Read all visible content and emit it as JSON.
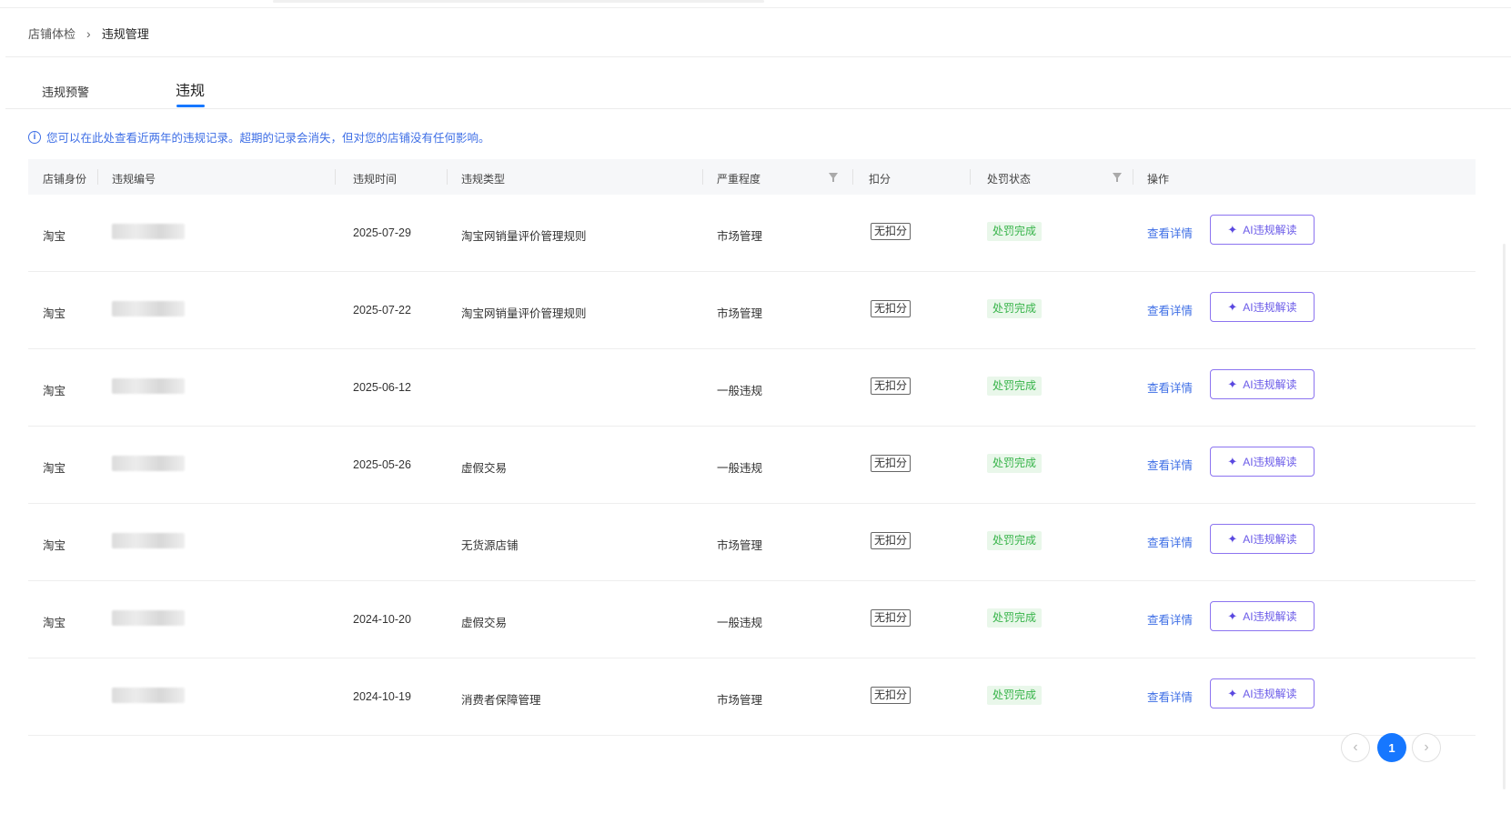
{
  "breadcrumb": {
    "parent": "店铺体检",
    "separator": "›",
    "current": "违规管理"
  },
  "tabs": [
    {
      "label": "违规预警"
    },
    {
      "label": "违规"
    }
  ],
  "notice": {
    "icon": "info-icon",
    "text": "您可以在此处查看近两年的违规记录。超期的记录会消失，但对您的店铺没有任何影响。"
  },
  "table": {
    "headers": {
      "shop": "店铺身份",
      "id": "违规编号",
      "time": "违规时间",
      "type": "违规类型",
      "severity": "严重程度",
      "score": "扣分",
      "status": "处罚状态",
      "action": "操作"
    },
    "rows": [
      {
        "shop": "淘宝",
        "time": "2025-07-29",
        "type": "淘宝网销量评价管理规则",
        "severity": "市场管理",
        "score": "无扣分",
        "status": "处罚完成",
        "view": "查看详情",
        "ai": "AI违规解读"
      },
      {
        "shop": "淘宝",
        "time": "2025-07-22",
        "type": "淘宝网销量评价管理规则",
        "severity": "市场管理",
        "score": "无扣分",
        "status": "处罚完成",
        "view": "查看详情",
        "ai": "AI违规解读"
      },
      {
        "shop": "淘宝",
        "time": "2025-06-12",
        "type": "",
        "severity": "一般违规",
        "score": "无扣分",
        "status": "处罚完成",
        "view": "查看详情",
        "ai": "AI违规解读"
      },
      {
        "shop": "淘宝",
        "time": "2025-05-26",
        "type": "虚假交易",
        "severity": "一般违规",
        "score": "无扣分",
        "status": "处罚完成",
        "view": "查看详情",
        "ai": "AI违规解读"
      },
      {
        "shop": "淘宝",
        "time": "",
        "type": "无货源店铺",
        "severity": "市场管理",
        "score": "无扣分",
        "status": "处罚完成",
        "view": "查看详情",
        "ai": "AI违规解读"
      },
      {
        "shop": "淘宝",
        "time": "2024-10-20",
        "type": "虚假交易",
        "severity": "一般违规",
        "score": "无扣分",
        "status": "处罚完成",
        "view": "查看详情",
        "ai": "AI违规解读"
      },
      {
        "shop": "",
        "time": "2024-10-19",
        "type": "消费者保障管理",
        "severity": "市场管理",
        "score": "无扣分",
        "status": "处罚完成",
        "view": "查看详情",
        "ai": "AI违规解读"
      }
    ]
  },
  "pagination": {
    "prev": "‹",
    "current": "1",
    "next": "›"
  },
  "colors": {
    "accent": "#1677ff",
    "link": "#3f6fe6",
    "ai_border": "#8c74f0",
    "status_bg": "#e9f7ea",
    "status_text": "#38b44a"
  }
}
